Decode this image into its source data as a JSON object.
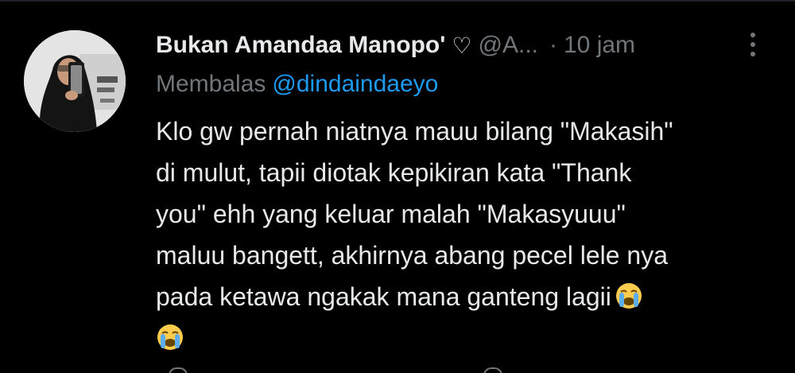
{
  "tweet": {
    "display_name": "Bukan Amandaa Manopo'",
    "name_emoji": "♡",
    "handle": "@A...",
    "separator": "·",
    "time": "10 jam",
    "reply_prefix": "Membalas",
    "reply_to": "@dindaindaeyo",
    "text_lines": [
      "Klo gw pernah niatnya mauu bilang \"Makasih\"",
      "di mulut, tapii diotak kepikiran kata \"Thank",
      "you\" ehh yang keluar malah \"Makasyuuu\"",
      "maluu bangett, akhirnya abang pecel lele nya",
      "pada ketawa ngakak mana ganteng lagii"
    ],
    "emoji_name": "loudly-crying-face"
  },
  "colors": {
    "background": "#000000",
    "text": "#e7e9ea",
    "secondary": "#71767b",
    "accent": "#1d9bf0"
  }
}
